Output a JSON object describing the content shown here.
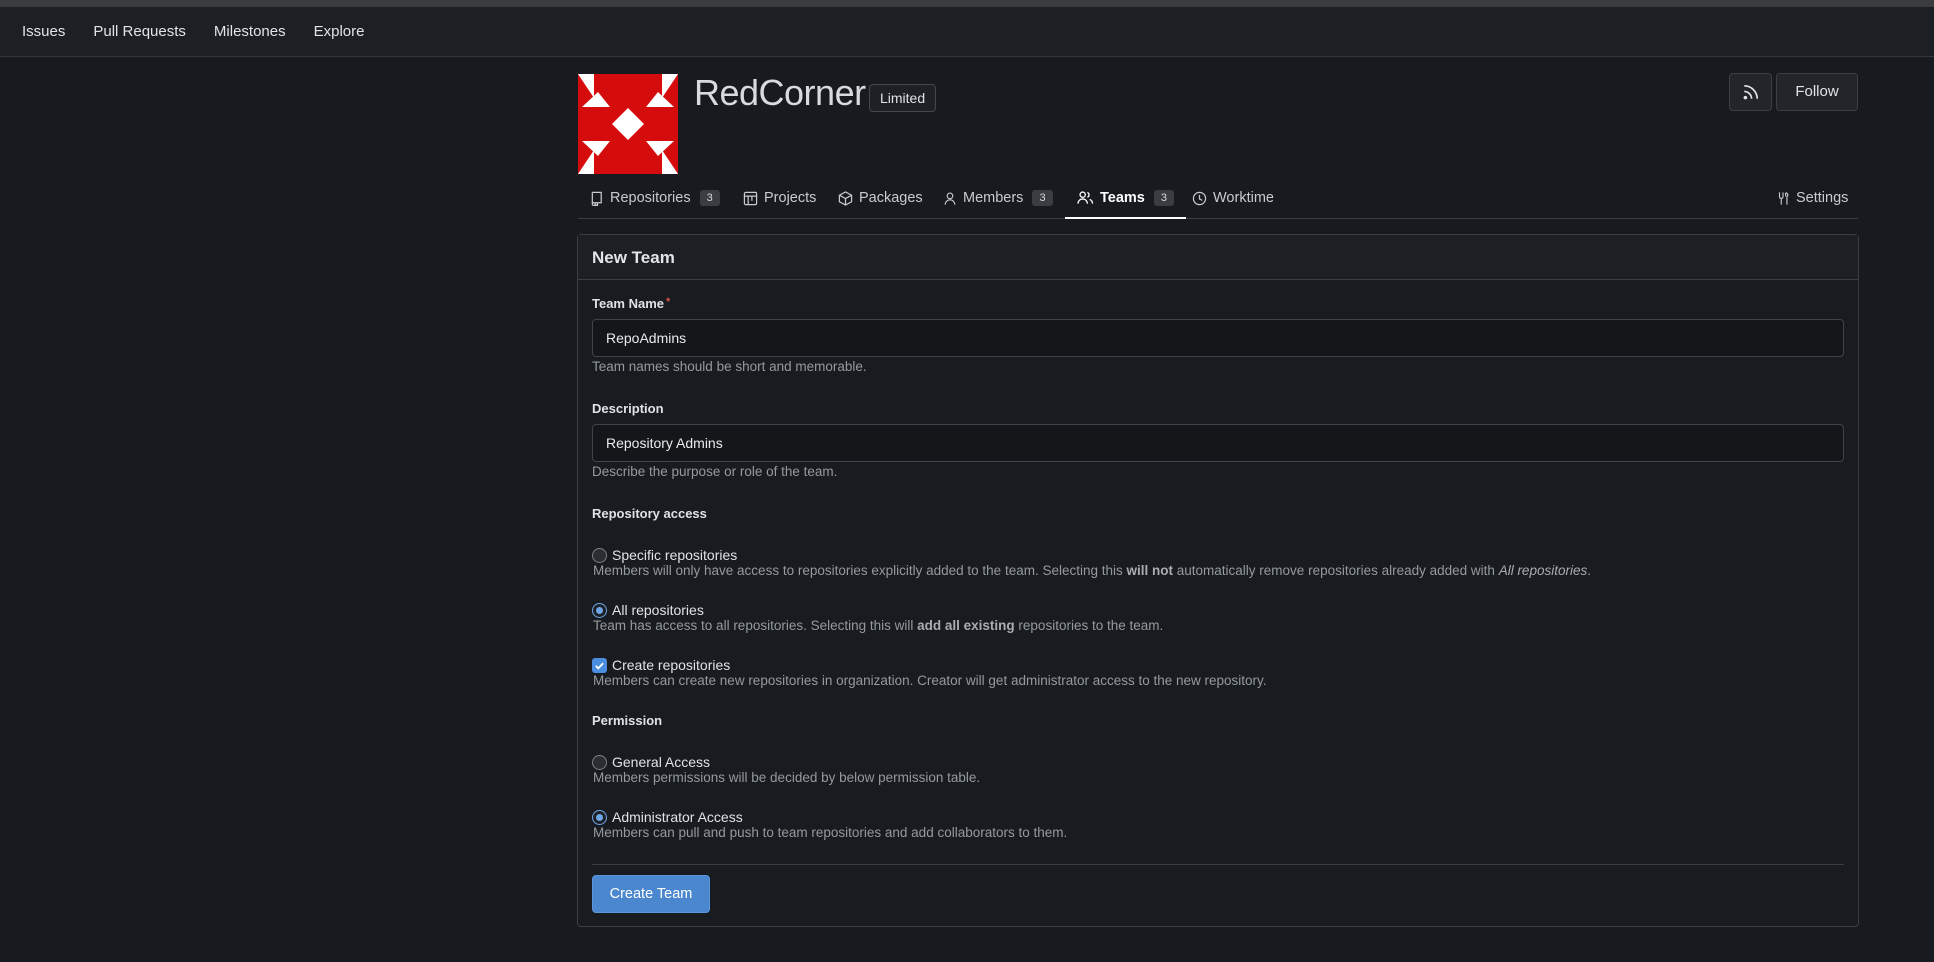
{
  "nav": {
    "items": [
      "Issues",
      "Pull Requests",
      "Milestones",
      "Explore"
    ]
  },
  "org": {
    "name": "RedCorner",
    "visibility_badge": "Limited",
    "follow_label": "Follow",
    "avatar_colors": {
      "primary": "#d50c0c",
      "background": "#ffffff"
    }
  },
  "tabs": [
    {
      "label": "Repositories",
      "count": "3",
      "icon": "repo-icon"
    },
    {
      "label": "Projects",
      "icon": "project-icon"
    },
    {
      "label": "Packages",
      "icon": "package-icon"
    },
    {
      "label": "Members",
      "count": "3",
      "icon": "person-icon"
    },
    {
      "label": "Teams",
      "count": "3",
      "icon": "people-icon",
      "active": true
    },
    {
      "label": "Worktime",
      "icon": "clock-icon"
    },
    {
      "label": "Settings",
      "icon": "tools-icon"
    }
  ],
  "form": {
    "title": "New Team",
    "team_name": {
      "label": "Team Name",
      "required_mark": "*",
      "value": "RepoAdmins",
      "help": "Team names should be short and memorable."
    },
    "description": {
      "label": "Description",
      "value": "Repository Admins",
      "help": "Describe the purpose or role of the team."
    },
    "repo_access": {
      "label": "Repository access",
      "specific": {
        "label": "Specific repositories",
        "help_a": "Members will only have access to repositories explicitly added to the team. Selecting this ",
        "help_b": "will not",
        "help_c": " automatically remove repositories already added with ",
        "help_d": "All repositories",
        "help_e": ".",
        "checked": false
      },
      "all": {
        "label": "All repositories",
        "help_a": "Team has access to all repositories. Selecting this will ",
        "help_b": "add all existing",
        "help_c": " repositories to the team.",
        "checked": true
      },
      "create": {
        "label": "Create repositories",
        "help": "Members can create new repositories in organization. Creator will get administrator access to the new repository.",
        "checked": true
      }
    },
    "permission": {
      "label": "Permission",
      "general": {
        "label": "General Access",
        "help": "Members permissions will be decided by below permission table.",
        "checked": false
      },
      "admin": {
        "label": "Administrator Access",
        "help": "Members can pull and push to team repositories and add collaborators to them.",
        "checked": true
      }
    },
    "submit_label": "Create Team"
  },
  "colors": {
    "accent": "#4a87cf",
    "background": "#171a1e",
    "panel": "#181b1f"
  }
}
